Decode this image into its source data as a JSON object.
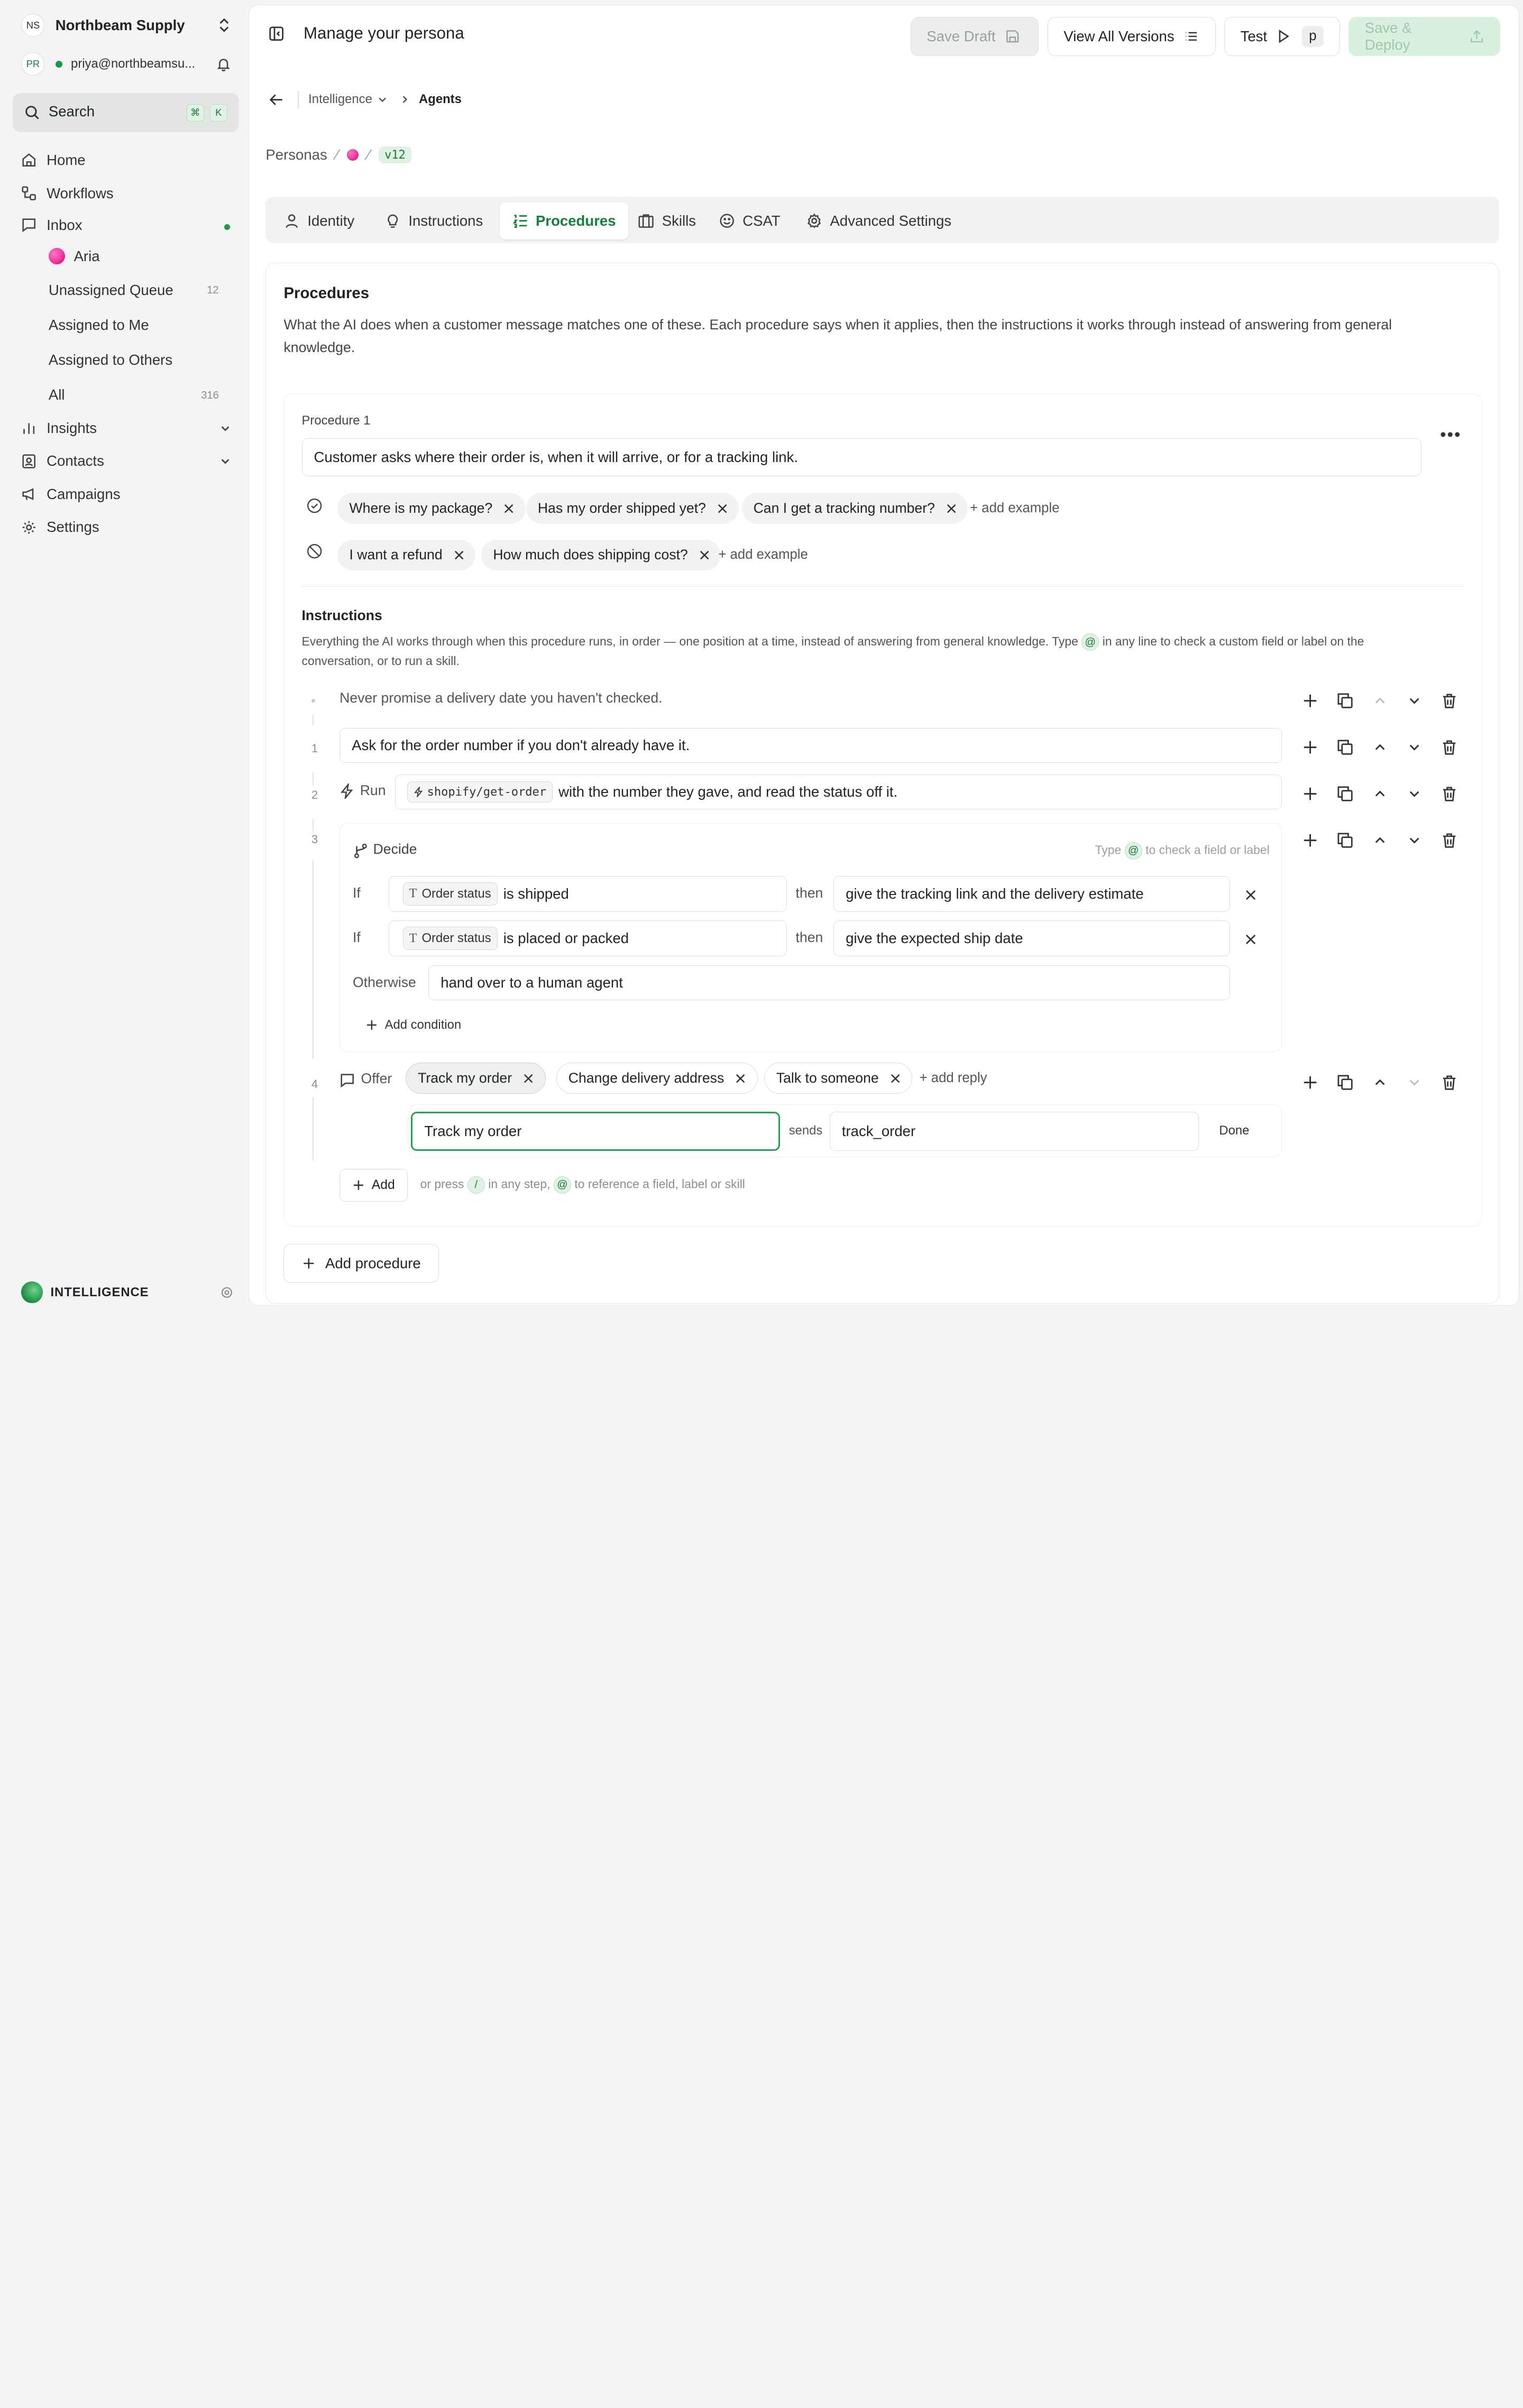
{
  "workspace": {
    "initials": "NS",
    "name": "Northbeam Supply"
  },
  "user": {
    "initials": "PR",
    "email": "priya@northbeamsu..."
  },
  "search": {
    "label": "Search",
    "key1": "⌘",
    "key2": "K"
  },
  "nav": {
    "home": "Home",
    "workflows": "Workflows",
    "inbox": "Inbox",
    "aria": "Aria",
    "unassigned": "Unassigned Queue",
    "unassigned_count": "12",
    "assigned_me": "Assigned to Me",
    "assigned_others": "Assigned to Others",
    "all": "All",
    "all_count": "316",
    "insights": "Insights",
    "contacts": "Contacts",
    "campaigns": "Campaigns",
    "settings": "Settings"
  },
  "footer": {
    "brand": "INTELLIGENCE"
  },
  "header": {
    "title": "Manage your persona",
    "save_draft": "Save Draft",
    "view_versions": "View All Versions",
    "test": "Test",
    "test_key": "p",
    "save_deploy": "Save & Deploy"
  },
  "breadcrumb": {
    "parent": "Intelligence",
    "current": "Agents"
  },
  "persona": {
    "root": "Personas",
    "version": "v12"
  },
  "tabs": {
    "identity": "Identity",
    "instructions": "Instructions",
    "procedures": "Procedures",
    "skills": "Skills",
    "csat": "CSAT",
    "advanced": "Advanced Settings"
  },
  "procedures": {
    "title": "Procedures",
    "description": "What the AI does when a customer message matches one of these. Each procedure says when it applies, then the instructions it works through instead of answering from general knowledge.",
    "add_procedure": "Add procedure",
    "p1": {
      "label": "Procedure 1",
      "trigger": "Customer asks where their order is, when it will arrive, or for a tracking link.",
      "positive": [
        "Where is my package?",
        "Has my order shipped yet?",
        "Can I get a tracking number?"
      ],
      "negative": [
        "I want a refund",
        "How much does shipping cost?"
      ],
      "add_example": "+ add example",
      "instructions_title": "Instructions",
      "instructions_desc_a": "Everything the AI works through when this procedure runs, in order — one position at a time, instead of answering from general knowledge. Type",
      "instructions_desc_b": "in any line to check a custom field or label on the conversation, or to run a skill.",
      "at": "@",
      "guard": "Never promise a delivery date you haven't checked.",
      "steps": {
        "n1": "1",
        "s1": "Ask for the order number if you don't already have it.",
        "n2": "2",
        "run_label": "Run",
        "skill": "shopify/get-order",
        "s2_rest": "with the number they gave, and read the status off it.",
        "n3": "3",
        "decide_label": "Decide",
        "decide_hint_a": "Type",
        "decide_hint_b": "to check a field or label",
        "if": "If",
        "then": "then",
        "field": "Order status",
        "c1_val": "is shipped",
        "c1_then": "give the tracking link and the delivery estimate",
        "c2_val": "is placed or packed",
        "c2_then": "give the expected ship date",
        "otherwise": "Otherwise",
        "otherwise_val": "hand over to a human agent",
        "add_condition": "Add condition",
        "n4": "4",
        "offer_label": "Offer",
        "replies": [
          "Track my order",
          "Change delivery address",
          "Talk to someone"
        ],
        "add_reply": "+ add reply",
        "edit_label": "Track my order",
        "sends": "sends",
        "edit_value": "track_order",
        "done": "Done"
      },
      "add": "Add",
      "hint_a": "or press",
      "slash": "/",
      "hint_b": "in any step,",
      "hint_c": "to reference a field, label or skill"
    }
  },
  "colors": {
    "accent": "#15803d",
    "badge": "#dff2e3"
  }
}
